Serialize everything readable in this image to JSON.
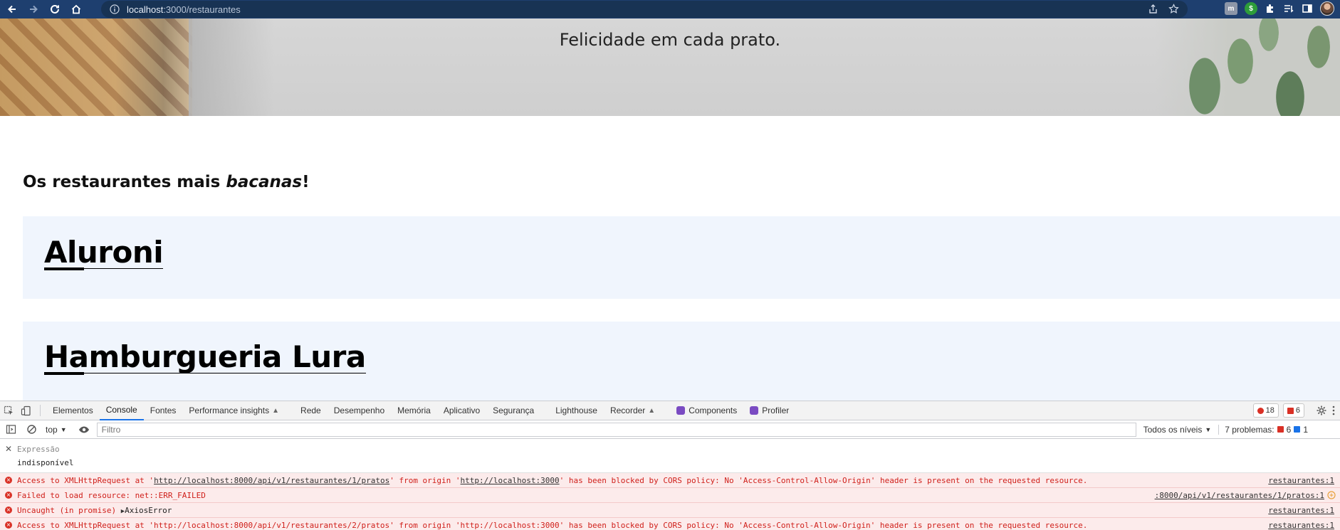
{
  "browser": {
    "url_host": "localhost",
    "url_path": ":3000/restaurantes"
  },
  "hero": {
    "tagline": "Felicidade em cada prato."
  },
  "page": {
    "section_title_prefix": "Os restaurantes mais ",
    "section_title_emphasis": "bacanas",
    "section_title_suffix": "!",
    "restaurants": [
      {
        "name": "Aluroni"
      },
      {
        "name": "Hamburgueria Lura"
      }
    ]
  },
  "devtools": {
    "tabs": [
      "Elementos",
      "Console",
      "Fontes",
      "Performance insights",
      "Rede",
      "Desempenho",
      "Memória",
      "Aplicativo",
      "Segurança",
      "Lighthouse",
      "Recorder",
      "Components",
      "Profiler"
    ],
    "active_tab": "Console",
    "error_count": "18",
    "warning_count": "6",
    "context": "top",
    "filter_placeholder": "Filtro",
    "levels": "Todos os níveis",
    "problems_label": "7 problemas:",
    "problems_errors": "6",
    "problems_info": "1",
    "expression_label": "Expressão",
    "expression_value": "indisponível",
    "logs": [
      {
        "pre": "Access to XMLHttpRequest at '",
        "link1": "http://localhost:8000/api/v1/restaurantes/1/pratos",
        "mid": "' from origin '",
        "link2": "http://localhost:3000",
        "post": "' has been blocked by CORS policy: No 'Access-Control-Allow-Origin' header is present on the requested resource.",
        "source": "restaurantes:1"
      },
      {
        "text": "Failed to load resource: net::ERR_FAILED",
        "source": ":8000/api/v1/restaurantes/1/pratos:1"
      },
      {
        "text": "Uncaught (in promise) ",
        "tail": "AxiosError",
        "source": "restaurantes:1"
      },
      {
        "text": "Access to XMLHttpRequest at 'http://localhost:8000/api/v1/restaurantes/2/pratos' from origin 'http://localhost:3000' has been blocked by CORS policy: No 'Access-Control-Allow-Origin' header is present on the requested resource.",
        "source": "restaurantes:1"
      }
    ]
  }
}
